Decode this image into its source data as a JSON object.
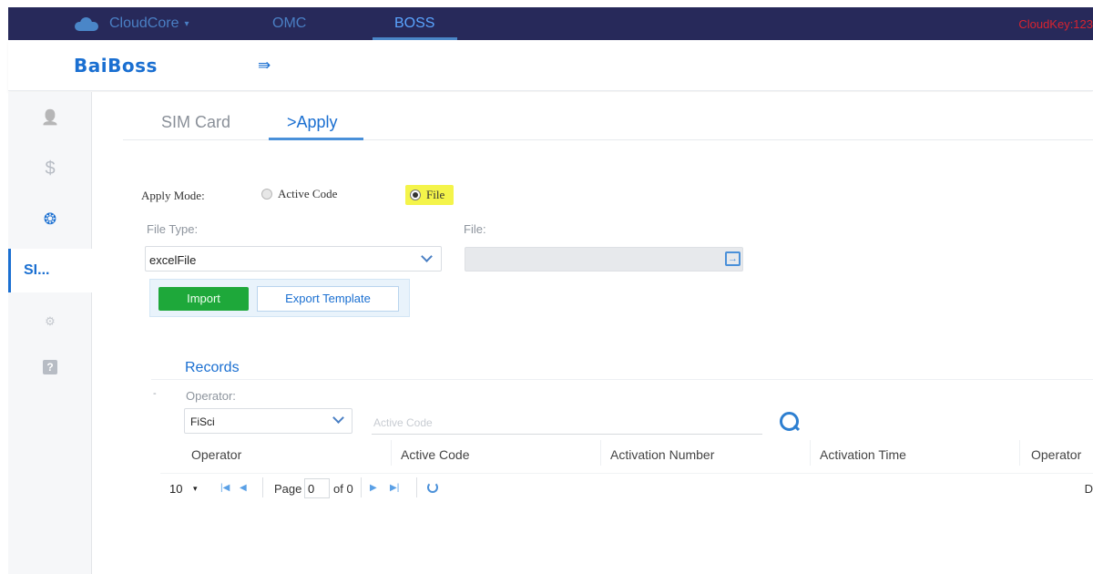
{
  "topnav": {
    "brand": "CloudCore",
    "brand_caret": "▾",
    "links": [
      "OMC",
      "BOSS"
    ],
    "cloudkey": "CloudKey:123"
  },
  "header": {
    "logo": "BaiBoss",
    "menu_icon": "menu-toggle-icon"
  },
  "sidebar": {
    "items": [
      {
        "icon": "user-icon",
        "glyph": "👤"
      },
      {
        "icon": "dollar-icon",
        "glyph": "$"
      },
      {
        "icon": "globe-icon",
        "glyph": "❂"
      },
      {
        "label": "SI..."
      },
      {
        "icon": "gears-icon",
        "glyph": "⚙"
      },
      {
        "icon": "help-icon",
        "glyph": "?"
      }
    ]
  },
  "tabs": [
    "SIM Card",
    ">Apply"
  ],
  "form": {
    "apply_mode_label": "Apply Mode:",
    "options": [
      "Active Code",
      "File"
    ],
    "selected_option": "File",
    "file_type_label": "File Type:",
    "file_type_value": "excelFile",
    "file_label": "File:",
    "import_label": "Import",
    "export_label": "Export Template"
  },
  "records": {
    "title": "Records",
    "dash": "-",
    "operator_label": "Operator:",
    "operator_value": "FiSci",
    "active_code_placeholder": "Active Code",
    "columns": [
      "Operator",
      "Active Code",
      "Activation Number",
      "Activation Time",
      "Operator"
    ]
  },
  "pager": {
    "page_size": "10",
    "page_size_caret": "▾",
    "first": "|◀",
    "prev": "◀",
    "page_label": "Page",
    "page_value": "0",
    "of_label": "of 0",
    "next": "▶",
    "last": "▶|",
    "right_text": "D"
  },
  "colors": {
    "nav_bg": "#27295a",
    "accent": "#1a6fd1",
    "import_green": "#1ea83a",
    "highlight_yellow": "#f4f44a",
    "cloudkey_red": "#d9232f"
  }
}
